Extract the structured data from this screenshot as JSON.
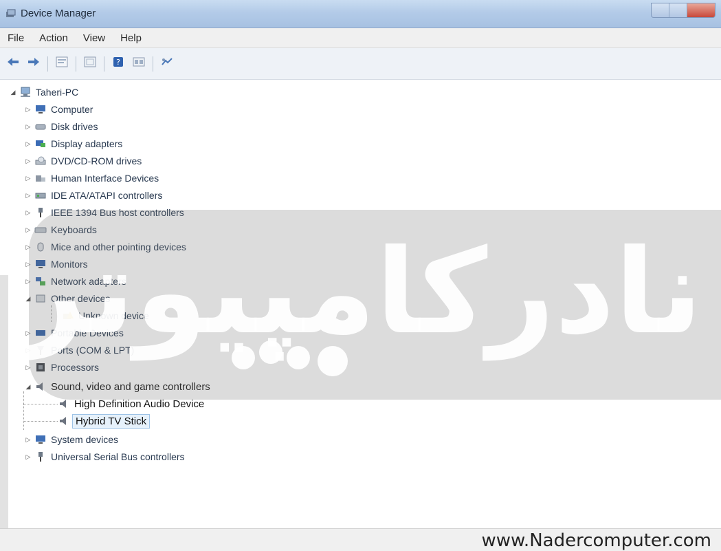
{
  "window": {
    "title": "Device Manager"
  },
  "menu": {
    "items": [
      "File",
      "Action",
      "View",
      "Help"
    ]
  },
  "toolbar": {
    "icons": [
      "back-arrow-icon",
      "forward-arrow-icon",
      "properties-icon",
      "scan-hardware-icon",
      "help-icon",
      "devices-view-icon",
      "update-driver-icon"
    ]
  },
  "tree": {
    "root": "Taheri-PC",
    "categories": [
      "Computer",
      "Disk drives",
      "Display adapters",
      "DVD/CD-ROM drives",
      "Human Interface Devices",
      "IDE ATA/ATAPI controllers",
      "IEEE 1394 Bus host controllers",
      "Keyboards",
      "Mice and other pointing devices",
      "Monitors",
      "Network adapters",
      "Other devices",
      "Unknown device",
      "Portable Devices",
      "Ports (COM & LPT)",
      "Processors",
      "Sound, video and game controllers",
      "High Definition Audio Device",
      "Hybrid TV Stick",
      "System devices",
      "Universal Serial Bus controllers"
    ],
    "selected": "Hybrid TV Stick"
  },
  "watermark": {
    "text": "نادرکامپیوتر"
  },
  "footer": {
    "website": "www.Nadercomputer.com"
  },
  "colors": {
    "titlebar": "#b3cbe8",
    "selection": "#e6f1fb",
    "watermark": "#787878"
  }
}
